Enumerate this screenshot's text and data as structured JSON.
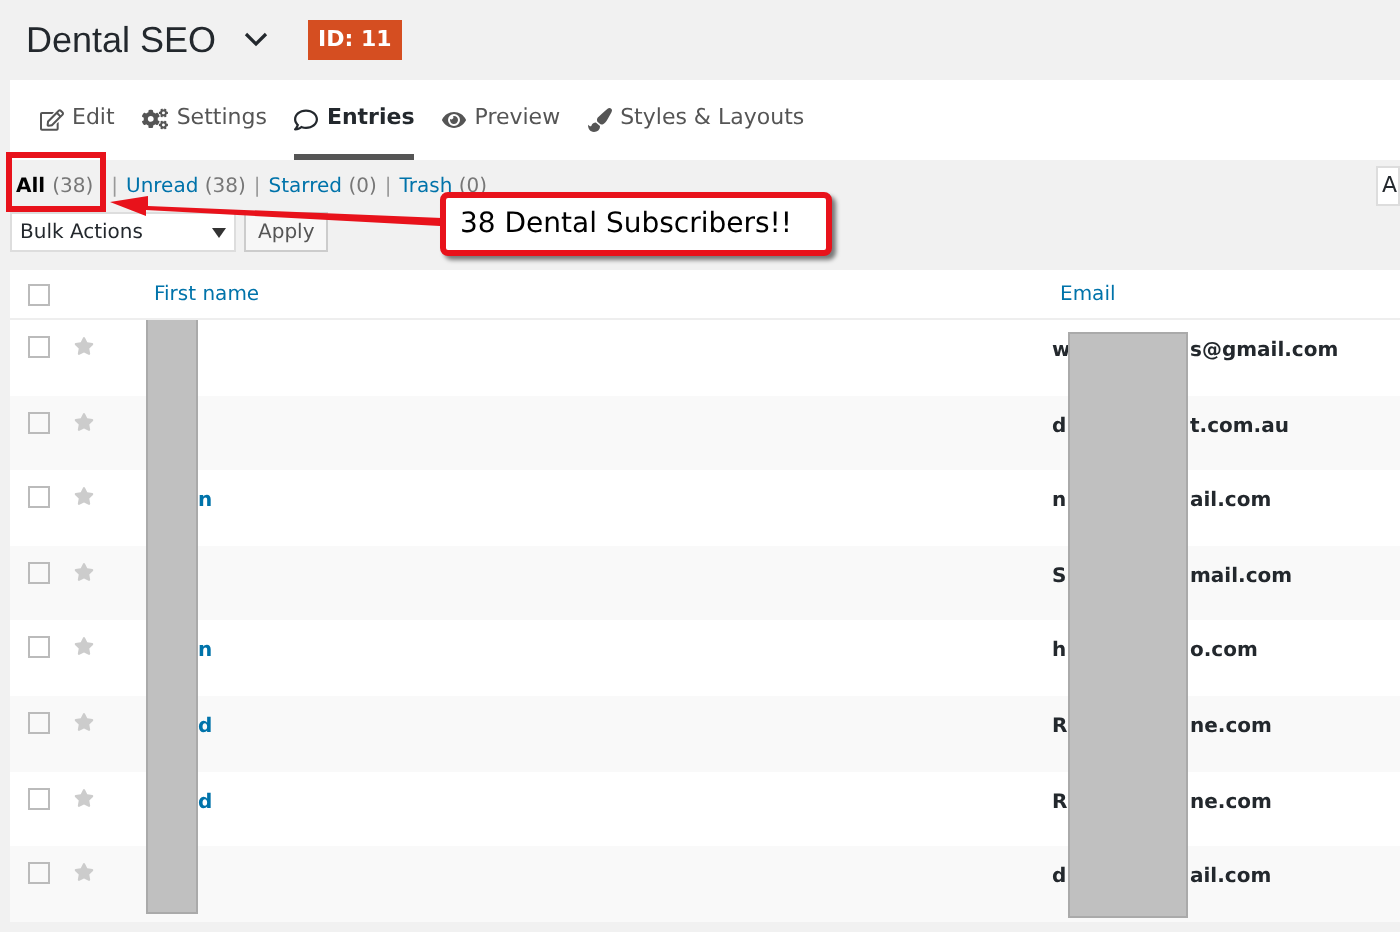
{
  "header": {
    "title": "Dental SEO",
    "id_badge": "ID: 11"
  },
  "tabs": [
    {
      "kind": "edit",
      "label": "Edit",
      "selected": false
    },
    {
      "kind": "settings",
      "label": "Settings",
      "selected": false
    },
    {
      "kind": "entries",
      "label": "Entries",
      "selected": true
    },
    {
      "kind": "preview",
      "label": "Preview",
      "selected": false
    },
    {
      "kind": "styles",
      "label": "Styles & Layouts",
      "selected": false
    }
  ],
  "filters": [
    {
      "label": "All",
      "count": "(38)",
      "selected": true
    },
    {
      "label": "Unread",
      "count": "(38)",
      "selected": false
    },
    {
      "label": "Starred",
      "count": "(0)",
      "selected": false
    },
    {
      "label": "Trash",
      "count": "(0)",
      "selected": false
    }
  ],
  "filter_separator": "|",
  "bulk_actions": {
    "value": "Bulk Actions",
    "apply": "Apply"
  },
  "right_field": {
    "value": "A"
  },
  "callout": {
    "text": "38 Dental Subscribers!!"
  },
  "table": {
    "select_all_checked": false,
    "columns": [
      "First name",
      "Email"
    ],
    "rows": [
      {
        "checked": false,
        "starred": false,
        "name_visible": "",
        "email_start": "w",
        "email_end": "s@gmail.com"
      },
      {
        "checked": false,
        "starred": false,
        "name_visible": "",
        "email_start": "d",
        "email_end": "t.com.au"
      },
      {
        "checked": false,
        "starred": false,
        "name_visible": "n",
        "email_start": "n",
        "email_end": "ail.com"
      },
      {
        "checked": false,
        "starred": false,
        "name_visible": "",
        "email_start": "S",
        "email_end": "mail.com"
      },
      {
        "checked": false,
        "starred": false,
        "name_visible": "n",
        "email_start": "h",
        "email_end": "o.com"
      },
      {
        "checked": false,
        "starred": false,
        "name_visible": "d",
        "email_start": "R",
        "email_end": "ne.com"
      },
      {
        "checked": false,
        "starred": false,
        "name_visible": "d",
        "email_start": "R",
        "email_end": "ne.com"
      },
      {
        "checked": false,
        "starred": false,
        "name_visible": "",
        "email_start": "d",
        "email_end": "ail.com"
      }
    ]
  }
}
